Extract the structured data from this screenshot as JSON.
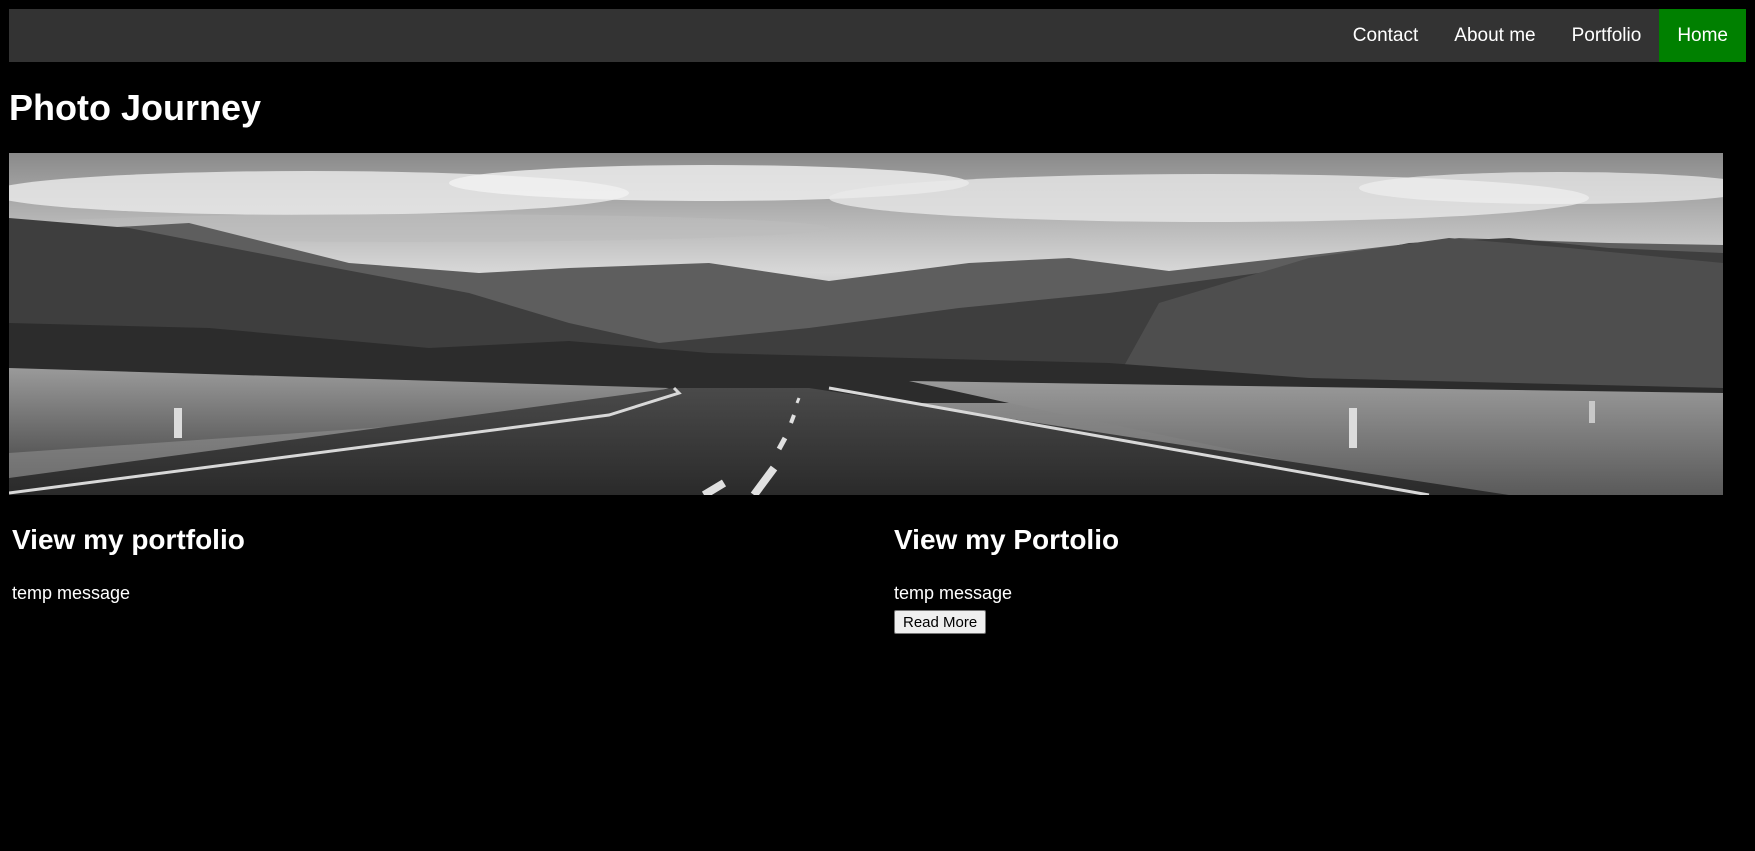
{
  "nav": {
    "items": [
      {
        "label": "Contact"
      },
      {
        "label": "About me"
      },
      {
        "label": "Portfolio"
      },
      {
        "label": "Home",
        "active": true
      }
    ],
    "bg_color": "#333333",
    "active_color": "#008000"
  },
  "page": {
    "title": "Photo Journey",
    "background": "#000000"
  },
  "columns": [
    {
      "heading": "View my portfolio",
      "text": "temp message"
    },
    {
      "heading": "View my Portolio",
      "text": "temp message",
      "button_label": "Read More"
    }
  ]
}
